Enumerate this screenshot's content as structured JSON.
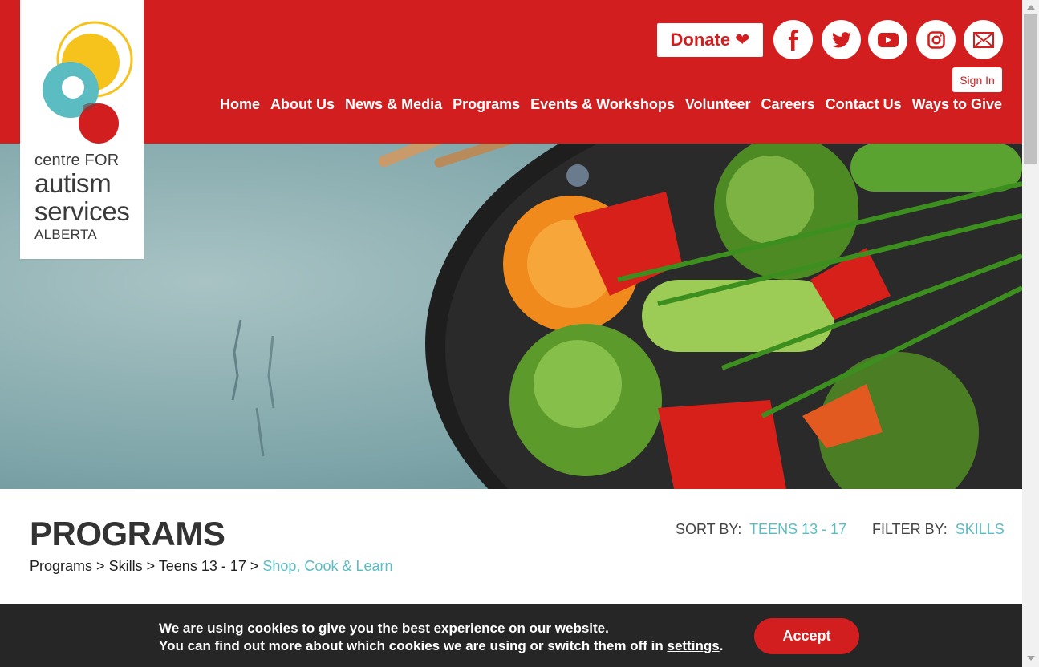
{
  "logo": {
    "line1": "centre FOR",
    "line2": "autism",
    "line3": "services",
    "line4": "ALBERTA"
  },
  "header": {
    "donate_label": "Donate",
    "heart_icon": "heart-icon",
    "sign_in_label": "Sign In",
    "social_icons": [
      "facebook-icon",
      "twitter-icon",
      "youtube-icon",
      "instagram-icon",
      "email-icon"
    ],
    "nav": [
      "Home",
      "About Us",
      "News & Media",
      "Programs",
      "Events & Workshops",
      "Volunteer",
      "Careers",
      "Contact Us",
      "Ways to Give"
    ]
  },
  "colors": {
    "brand_red": "#d21e1e",
    "teal": "#5bbcc2",
    "cookie_bg": "#262626"
  },
  "main": {
    "title": "PROGRAMS",
    "sort_label": "SORT BY:",
    "sort_value": "TEENS 13 - 17",
    "filter_label": "FILTER BY:",
    "filter_value": "SKILLS",
    "breadcrumb": {
      "items": [
        "Programs",
        "Skills",
        "Teens 13 - 17"
      ],
      "separator": ">",
      "current": "Shop, Cook & Learn"
    }
  },
  "cookie": {
    "line1": "We are using cookies to give you the best experience on our website.",
    "line2_prefix": "You can find out more about which cookies we are using or switch them off in ",
    "settings_link": "settings",
    "line2_suffix": ".",
    "accept_label": "Accept"
  }
}
